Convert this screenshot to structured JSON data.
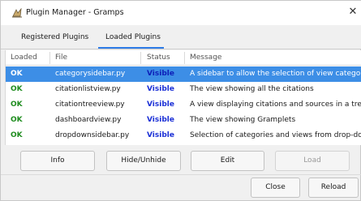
{
  "window": {
    "title": "Plugin Manager - Gramps",
    "close_glyph": "✕"
  },
  "tabs": [
    {
      "label": "Registered Plugins",
      "active": false
    },
    {
      "label": "Loaded Plugins",
      "active": true
    }
  ],
  "table": {
    "headers": [
      "Loaded",
      "File",
      "Status",
      "Message"
    ],
    "rows": [
      {
        "loaded": "OK",
        "file": "categorysidebar.py",
        "status": "Visible",
        "message": "A sidebar to allow the selection of view categories",
        "selected": true
      },
      {
        "loaded": "OK",
        "file": "citationlistview.py",
        "status": "Visible",
        "message": "The view showing all the citations",
        "selected": false
      },
      {
        "loaded": "OK",
        "file": "citationtreeview.py",
        "status": "Visible",
        "message": "A view displaying citations and sources in a tree fo",
        "selected": false
      },
      {
        "loaded": "OK",
        "file": "dashboardview.py",
        "status": "Visible",
        "message": "The view showing Gramplets",
        "selected": false
      },
      {
        "loaded": "OK",
        "file": "dropdownsidebar.py",
        "status": "Visible",
        "message": "Selection of categories and views from drop-down",
        "selected": false
      }
    ]
  },
  "actions": {
    "info": "Info",
    "hide_unhide": "Hide/Unhide",
    "edit": "Edit",
    "load": "Load"
  },
  "footer": {
    "close": "Close",
    "reload": "Reload"
  },
  "colors": {
    "ok_green": "#1e8c1e",
    "visible_blue": "#1a2fd6",
    "selection": "#3d8ee6",
    "tab_accent": "#2e7be6"
  }
}
